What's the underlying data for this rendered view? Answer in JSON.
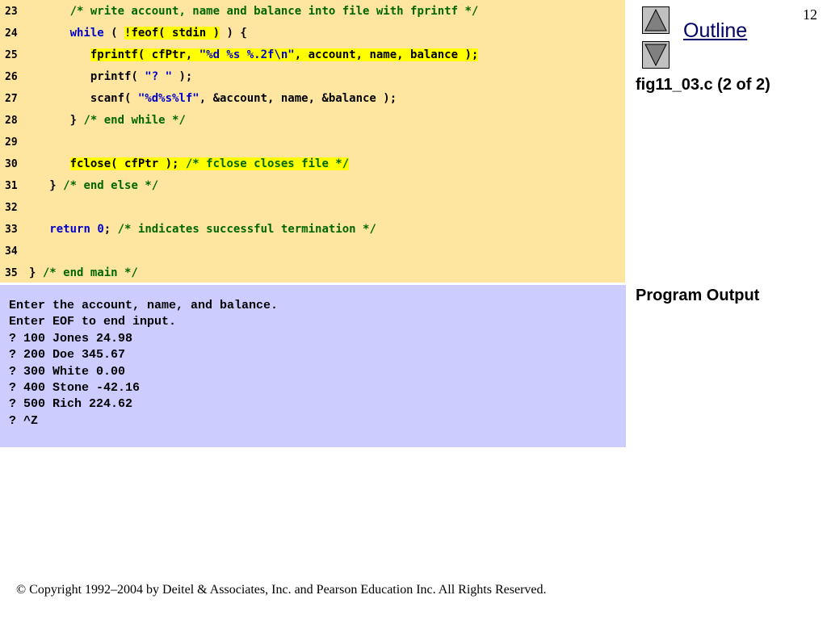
{
  "page_number": "12",
  "nav": {
    "outline_label": "Outline",
    "up_icon": "triangle-up-icon",
    "down_icon": "triangle-down-icon"
  },
  "figure_caption": "fig11_03.c (2 of 2)",
  "program_output_label": "Program Output",
  "code": {
    "lines": [
      {
        "n": "23",
        "segs": [
          {
            "t": "      "
          },
          {
            "t": "/* write account, name and balance into file with fprintf */",
            "c": "cm"
          }
        ]
      },
      {
        "n": "24",
        "segs": [
          {
            "t": "      "
          },
          {
            "t": "while",
            "c": "kw"
          },
          {
            "t": " ( "
          },
          {
            "t": "!feof( stdin )",
            "h": true
          },
          {
            "t": " ) {"
          }
        ]
      },
      {
        "n": "25",
        "segs": [
          {
            "t": "         "
          },
          {
            "t": "fprintf( cfPtr, ",
            "h": true
          },
          {
            "t": "\"%d %s %.2f\\n\"",
            "c": "st",
            "h": true
          },
          {
            "t": ", account, name, balance );",
            "h": true
          }
        ]
      },
      {
        "n": "26",
        "segs": [
          {
            "t": "         printf( "
          },
          {
            "t": "\"? \"",
            "c": "st"
          },
          {
            "t": " );"
          }
        ]
      },
      {
        "n": "27",
        "segs": [
          {
            "t": "         scanf( "
          },
          {
            "t": "\"%d%s%lf\"",
            "c": "st"
          },
          {
            "t": ", &account, name, &balance );"
          }
        ]
      },
      {
        "n": "28",
        "segs": [
          {
            "t": "      } "
          },
          {
            "t": "/* end while */",
            "c": "cm"
          }
        ]
      },
      {
        "n": "29",
        "segs": []
      },
      {
        "n": "30",
        "segs": [
          {
            "t": "      "
          },
          {
            "t": "fclose( cfPtr ); ",
            "h": true
          },
          {
            "t": "/* fclose closes file */",
            "c": "cm",
            "h": true
          }
        ]
      },
      {
        "n": "31",
        "segs": [
          {
            "t": "   } "
          },
          {
            "t": "/* end else */",
            "c": "cm"
          }
        ]
      },
      {
        "n": "32",
        "segs": []
      },
      {
        "n": "33",
        "segs": [
          {
            "t": "   "
          },
          {
            "t": "return",
            "c": "kw"
          },
          {
            "t": " "
          },
          {
            "t": "0",
            "c": "num"
          },
          {
            "t": "; "
          },
          {
            "t": "/* indicates successful termination */",
            "c": "cm"
          }
        ]
      },
      {
        "n": "34",
        "segs": []
      },
      {
        "n": "35",
        "segs": [
          {
            "t": "} "
          },
          {
            "t": "/* end main */",
            "c": "cm"
          }
        ]
      }
    ]
  },
  "output": {
    "lines": [
      "Enter the account, name, and balance.",
      "Enter EOF to end input.",
      "? 100 Jones 24.98",
      "? 200 Doe 345.67",
      "? 300 White 0.00",
      "? 400 Stone -42.16",
      "? 500 Rich 224.62",
      "? ^Z"
    ]
  },
  "copyright": "© Copyright 1992–2004 by Deitel & Associates, Inc. and Pearson Education Inc. All Rights Reserved."
}
